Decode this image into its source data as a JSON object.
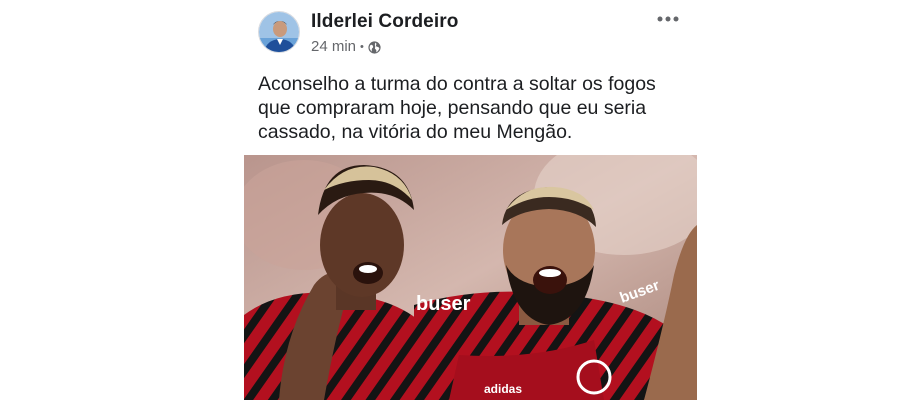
{
  "post": {
    "author": "Ilderlei Cordeiro",
    "time": "24 min",
    "separator": "•",
    "privacy_icon": "globe-icon",
    "more_icon": "more-options-icon",
    "text": "Aconselho a turma do contra a soltar os fogos\nque compraram hoje, pensando que eu seria\ncassado, na vitória do meu Mengão.",
    "image": {
      "description_icon": "photo",
      "jersey_sponsor_left": "buser",
      "jersey_sponsor_right": "buser",
      "jersey_brand": "adidas"
    }
  },
  "colors": {
    "text": "#1c1e21",
    "secondary": "#65676b",
    "jersey_red": "#c8102e",
    "jersey_black": "#111111"
  }
}
